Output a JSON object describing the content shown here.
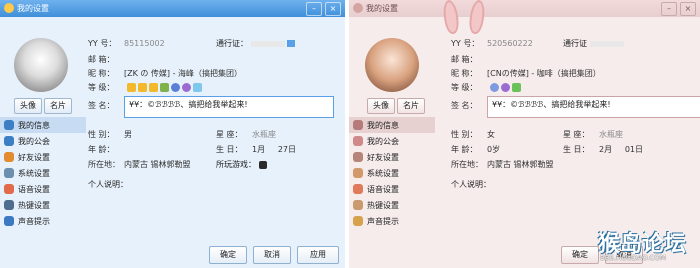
{
  "colors": {
    "blue_title": "#4a98e0",
    "pink_title": "#ebd3d3",
    "accent": "#5aa0e6"
  },
  "left_window": {
    "title": "我的设置",
    "avatar_buttons": [
      "头像",
      "名片"
    ],
    "nav": [
      {
        "label": "我的信息",
        "icon": "person-icon",
        "active": true
      },
      {
        "label": "我的公会",
        "icon": "flag-icon"
      },
      {
        "label": "好友设置",
        "icon": "friends-icon"
      },
      {
        "label": "系统设置",
        "icon": "gear-icon"
      },
      {
        "label": "语音设置",
        "icon": "speaker-icon"
      },
      {
        "label": "热键设置",
        "icon": "keyboard-icon"
      },
      {
        "label": "声音提示",
        "icon": "music-note-icon"
      }
    ],
    "yy_label": "YY 号：",
    "yy_value": "85115002",
    "pass_label": "通行证：",
    "mail_label": "邮    箱：",
    "nick_label": "昵    称：",
    "nick_value": "[ZK の 传媒] - 海峰（搞把集团）",
    "level_label": "等    级：",
    "sig_label": "签    名：",
    "sig_value": "¥¥：©ℬℬℬℬ、搞把给我举起来!",
    "gender_label": "性    别：",
    "gender_value": "男",
    "zodiac_label": "星    座：",
    "zodiac_value": "水瓶座",
    "age_label": "年    龄：",
    "birthday_label": "生    日：",
    "birthday_month": "1月",
    "birthday_day": "27日",
    "location_label": "所在地：",
    "location_value": "内蒙古  锡林郭勒盟",
    "games_label": "所玩游戏：",
    "bio_label": "个人说明：",
    "footer": [
      "确定",
      "取消",
      "应用"
    ]
  },
  "right_window": {
    "title": "我的设置",
    "avatar_buttons": [
      "头像",
      "名片"
    ],
    "nav": [
      {
        "label": "我的信息",
        "icon": "person-icon",
        "active": true
      },
      {
        "label": "我的公会",
        "icon": "flag-icon"
      },
      {
        "label": "好友设置",
        "icon": "friends-icon"
      },
      {
        "label": "系统设置",
        "icon": "gear-icon"
      },
      {
        "label": "语音设置",
        "icon": "speaker-icon"
      },
      {
        "label": "热键设置",
        "icon": "keyboard-icon"
      },
      {
        "label": "声音提示",
        "icon": "music-note-icon"
      }
    ],
    "yy_label": "YY 号：",
    "yy_value": "520560222",
    "pass_label": "通行证",
    "mail_label": "邮    箱：",
    "nick_label": "昵    称：",
    "nick_value": "[CNの传媒] - 咖啡（搞把集团）",
    "level_label": "等    级：",
    "sig_label": "签    名：",
    "sig_value": "¥¥：©ℬℬℬℬ、搞把给我举起来!",
    "gender_label": "性    别：",
    "gender_value": "女",
    "zodiac_label": "星    座：",
    "zodiac_value": "水瓶座",
    "age_label": "年    龄：",
    "age_value": "0岁",
    "birthday_label": "生    日：",
    "birthday_month": "2月",
    "birthday_day": "01日",
    "location_label": "所在地：",
    "location_value": "内蒙古  锡林郭勒盟",
    "bio_label": "个人说明：",
    "footer": [
      "确定",
      "取消"
    ]
  },
  "watermark": {
    "big": "猴岛论坛",
    "small": "BBS.HOUDAO.COM"
  }
}
